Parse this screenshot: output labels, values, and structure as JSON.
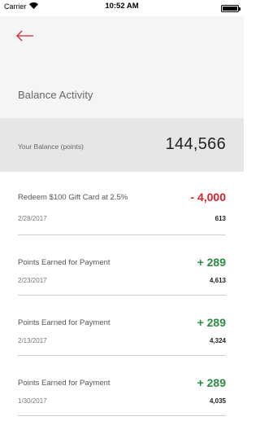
{
  "status_bar": {
    "carrier": "Carrier",
    "time": "10:52 AM"
  },
  "header": {
    "back_icon": "arrow-left-icon",
    "title": "Balance Activity"
  },
  "balance": {
    "label": "Your Balance (points)",
    "value": "144,566"
  },
  "accent_colors": {
    "negative": "#d6242a",
    "positive": "#2e8b44",
    "back_arrow": "#d6242a"
  },
  "activity": [
    {
      "description": "Redeem $100 Gift Card at 2.5%",
      "date": "2/28/2017",
      "amount": "- 4,000",
      "type": "neg",
      "balance": "613"
    },
    {
      "description": "Points Earned for Payment",
      "date": "2/23/2017",
      "amount": "+ 289",
      "type": "pos",
      "balance": "4,613"
    },
    {
      "description": "Points Earned for Payment",
      "date": "2/13/2017",
      "amount": "+ 289",
      "type": "pos",
      "balance": "4,324"
    },
    {
      "description": "Points Earned for Payment",
      "date": "1/30/2017",
      "amount": "+ 289",
      "type": "pos",
      "balance": "4,035"
    }
  ]
}
